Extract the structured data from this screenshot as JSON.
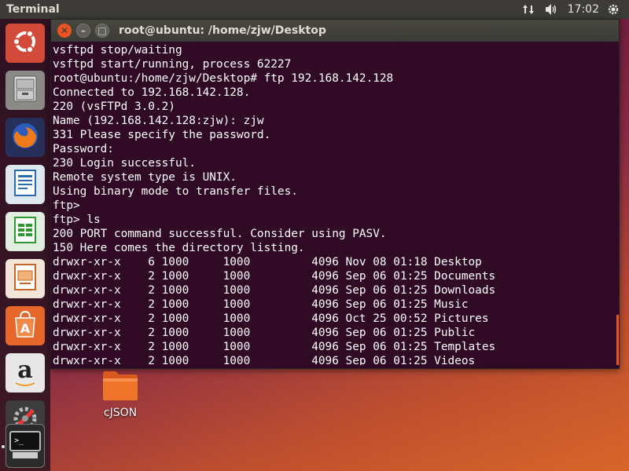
{
  "top_panel": {
    "app_title": "Terminal",
    "clock": "17:02",
    "network_icon": "network-updown-icon",
    "volume_icon": "volume-icon",
    "settings_icon": "gear-icon"
  },
  "launcher": {
    "items": [
      {
        "name": "ubuntu-dash",
        "icon": "ubuntu-logo-icon"
      },
      {
        "name": "files",
        "icon": "file-cabinet-icon"
      },
      {
        "name": "firefox",
        "icon": "firefox-icon"
      },
      {
        "name": "writer",
        "icon": "writer-icon"
      },
      {
        "name": "calc",
        "icon": "spreadsheet-icon"
      },
      {
        "name": "impress",
        "icon": "presentation-icon"
      },
      {
        "name": "software",
        "icon": "software-center-icon"
      },
      {
        "name": "amazon",
        "icon": "amazon-icon",
        "label": "a"
      },
      {
        "name": "settings",
        "icon": "system-settings-icon"
      },
      {
        "name": "terminal",
        "icon": "terminal-icon"
      }
    ]
  },
  "window": {
    "title": "root@ubuntu: /home/zjw/Desktop",
    "close_glyph": "✕",
    "min_glyph": "–",
    "max_glyph": "□"
  },
  "terminal": {
    "lines": [
      "vsftpd stop/waiting",
      "vsftpd start/running, process 62227",
      "root@ubuntu:/home/zjw/Desktop# ftp 192.168.142.128",
      "Connected to 192.168.142.128.",
      "220 (vsFTPd 3.0.2)",
      "Name (192.168.142.128:zjw): zjw",
      "331 Please specify the password.",
      "Password:",
      "230 Login successful.",
      "Remote system type is UNIX.",
      "Using binary mode to transfer files.",
      "ftp>",
      "ftp> ls",
      "200 PORT command successful. Consider using PASV.",
      "150 Here comes the directory listing.",
      "drwxr-xr-x    6 1000     1000         4096 Nov 08 01:18 Desktop",
      "drwxr-xr-x    2 1000     1000         4096 Sep 06 01:25 Documents",
      "drwxr-xr-x    2 1000     1000         4096 Sep 06 01:25 Downloads",
      "drwxr-xr-x    2 1000     1000         4096 Sep 06 01:25 Music",
      "drwxr-xr-x    2 1000     1000         4096 Oct 25 00:52 Pictures",
      "drwxr-xr-x    2 1000     1000         4096 Sep 06 01:25 Public",
      "drwxr-xr-x    2 1000     1000         4096 Sep 06 01:25 Templates",
      "drwxr-xr-x    2 1000     1000         4096 Sep 06 01:25 Videos"
    ]
  },
  "desktop": {
    "folder_label": "cJSON",
    "folder_icon": "folder-icon"
  },
  "colors": {
    "terminal_bg": "#300a24",
    "accent": "#e95420",
    "panel": "#3c3b37"
  }
}
